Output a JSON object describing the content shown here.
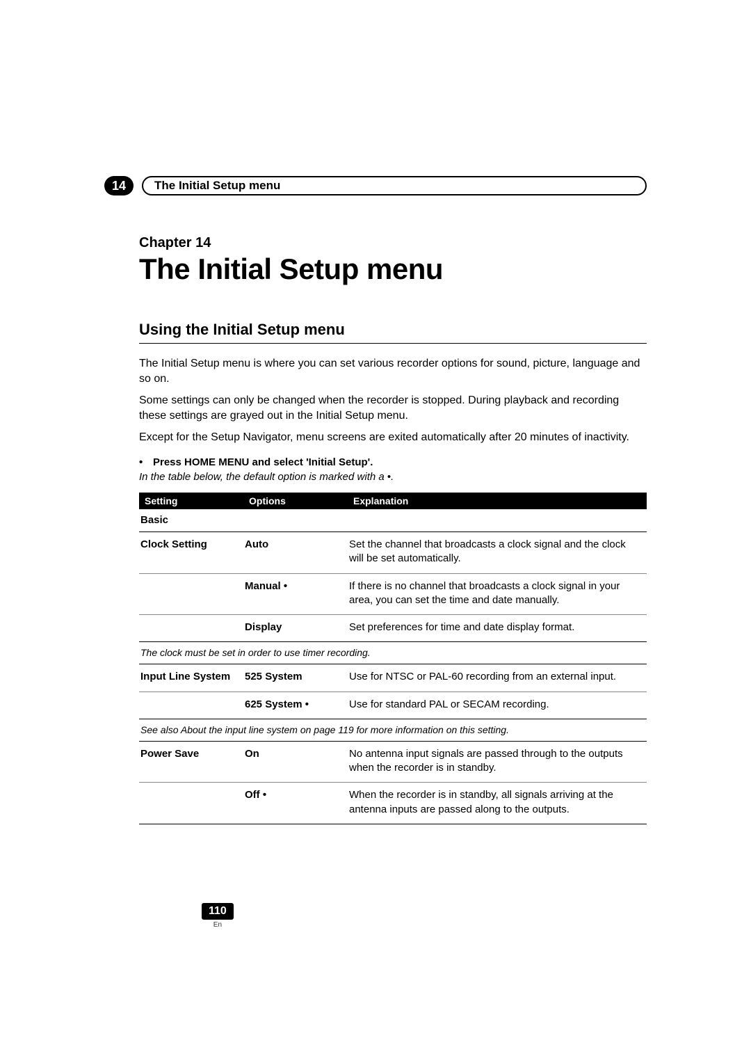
{
  "header": {
    "chapter_number": "14",
    "pill_title": "The Initial Setup menu"
  },
  "chapter": {
    "label": "Chapter 14",
    "title": "The Initial Setup menu"
  },
  "section": {
    "heading": "Using the Initial Setup menu",
    "paragraphs": [
      "The Initial Setup menu is where you can set various recorder options for sound, picture, language and so on.",
      "Some settings can only be changed when the recorder is stopped. During playback and recording these settings are grayed out in the Initial Setup menu.",
      "Except for the Setup Navigator, menu screens are exited automatically after 20 minutes of inactivity."
    ],
    "action": "Press HOME MENU and select 'Initial Setup'.",
    "note_prefix": "In the table below, the default option is marked with a",
    "note_marker": "•",
    "note_suffix": "."
  },
  "table": {
    "headers": {
      "setting": "Setting",
      "options": "Options",
      "explanation": "Explanation"
    },
    "group_label": "Basic",
    "rows": [
      {
        "setting": "Clock Setting",
        "option": "Auto",
        "default": false,
        "explanation": "Set the channel that broadcasts a clock signal and the clock will be set automatically."
      },
      {
        "setting": "",
        "option": "Manual",
        "default": true,
        "explanation": "If there is no channel that broadcasts a clock signal in your area, you can set the time and date manually."
      },
      {
        "setting": "",
        "option": "Display",
        "default": false,
        "explanation": "Set preferences for time and date display format."
      }
    ],
    "note1": "The clock must be set in order to use timer recording.",
    "rows2": [
      {
        "setting": "Input Line System",
        "option": "525 System",
        "default": false,
        "explanation": "Use for NTSC or PAL-60 recording from an external input."
      },
      {
        "setting": "",
        "option": "625 System",
        "default": true,
        "explanation": "Use for standard PAL or SECAM recording."
      }
    ],
    "note2": "See also About the input line system on page 119 for more information on this setting.",
    "rows3": [
      {
        "setting": "Power Save",
        "option": "On",
        "default": false,
        "explanation": "No antenna input signals are passed through to the outputs when the recorder is in standby."
      },
      {
        "setting": "",
        "option": "Off",
        "default": true,
        "explanation": "When the recorder is in standby, all signals arriving at the antenna inputs are passed along to the outputs."
      }
    ]
  },
  "footer": {
    "page": "110",
    "lang": "En"
  },
  "default_marker": "•"
}
